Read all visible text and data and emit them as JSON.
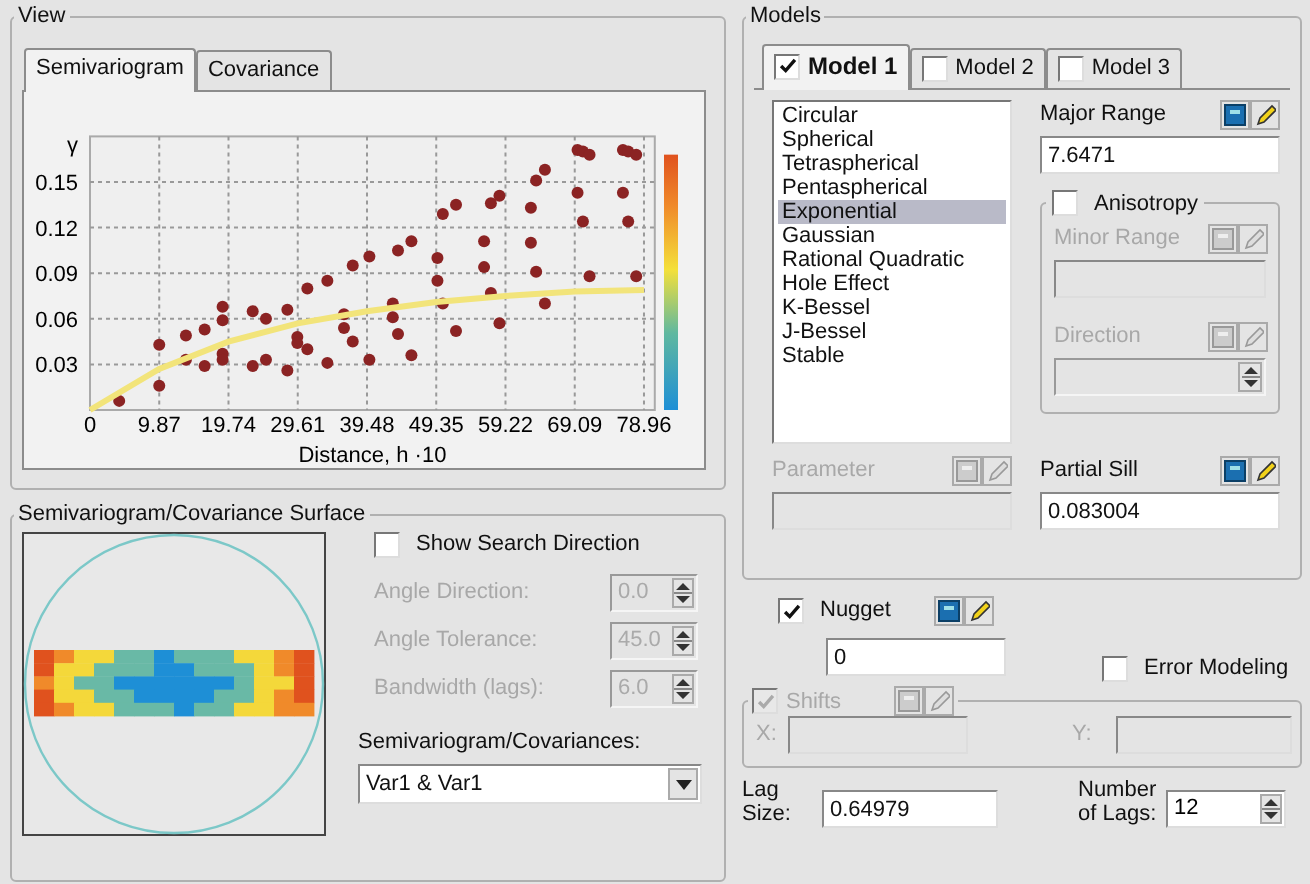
{
  "view": {
    "title": "View",
    "tabs": [
      {
        "label": "Semivariogram",
        "selected": true
      },
      {
        "label": "Covariance",
        "selected": false
      }
    ],
    "chart_data": {
      "type": "scatter",
      "xlabel": "Distance, h ·10",
      "ylabel": "γ",
      "xlim": [
        0,
        80.5
      ],
      "ylim": [
        0,
        0.18
      ],
      "xticks": [
        {
          "value": 0,
          "label": "0"
        },
        {
          "value": 9.87,
          "label": "9.87"
        },
        {
          "value": 19.74,
          "label": "19.74"
        },
        {
          "value": 29.61,
          "label": "29.61"
        },
        {
          "value": 39.48,
          "label": "39.48"
        },
        {
          "value": 49.35,
          "label": "49.35"
        },
        {
          "value": 59.22,
          "label": "59.22"
        },
        {
          "value": 69.09,
          "label": "69.09"
        },
        {
          "value": 78.96,
          "label": "78.96"
        }
      ],
      "yticks": [
        {
          "value": 0.03,
          "label": "0.03"
        },
        {
          "value": 0.06,
          "label": "0.06"
        },
        {
          "value": 0.09,
          "label": "0.09"
        },
        {
          "value": 0.12,
          "label": "0.12"
        },
        {
          "value": 0.15,
          "label": "0.15"
        }
      ],
      "x": [
        4.16,
        9.87,
        9.87,
        13.67,
        13.67,
        16.34,
        16.34,
        18.9,
        18.9,
        18.9,
        18.9,
        23.19,
        23.19,
        25.08,
        25.08,
        28.13,
        28.13,
        29.55,
        29.55,
        30.98,
        30.98,
        33.83,
        33.83,
        36.2,
        36.2,
        37.45,
        37.45,
        39.82,
        39.82,
        43.16,
        43.16,
        43.9,
        43.9,
        45.81,
        45.81,
        49.52,
        49.52,
        50.29,
        50.29,
        52.17,
        52.17,
        56.17,
        56.17,
        57.14,
        57.14,
        58.36,
        58.36,
        62.84,
        62.84,
        63.59,
        63.59,
        64.84,
        64.84,
        69.49,
        69.49,
        70.26,
        70.26,
        71.2,
        71.2,
        75.96,
        75.96,
        76.71,
        76.71,
        77.85,
        77.85
      ],
      "grid": true,
      "series": [
        {
          "color": "#8b2323",
          "values": [
            0.006,
            0.016,
            0.043,
            0.049,
            0.033,
            0.053,
            0.029,
            0.068,
            0.059,
            0.037,
            0.033,
            0.065,
            0.029,
            0.06,
            0.033,
            0.066,
            0.026,
            0.048,
            0.044,
            0.04,
            0.08,
            0.085,
            0.031,
            0.063,
            0.054,
            0.045,
            0.095,
            0.101,
            0.033,
            0.07,
            0.061,
            0.05,
            0.105,
            0.111,
            0.036,
            0.1,
            0.085,
            0.07,
            0.129,
            0.135,
            0.052,
            0.111,
            0.094,
            0.136,
            0.077,
            0.141,
            0.057,
            0.133,
            0.11,
            0.151,
            0.091,
            0.158,
            0.07,
            0.171,
            0.143,
            0.17,
            0.124,
            0.168,
            0.088,
            0.171,
            0.143,
            0.17,
            0.124,
            0.168,
            0.088
          ]
        },
        {
          "color": "#f2e47a",
          "type": "line",
          "x": [
            0,
            9.87,
            19.74,
            29.61,
            39.48,
            49.35,
            59.22,
            69.09,
            78.96
          ],
          "values": [
            0,
            0.027,
            0.045,
            0.057,
            0.065,
            0.071,
            0.075,
            0.078,
            0.079
          ]
        }
      ]
    }
  },
  "surface": {
    "title": "Semivariogram/Covariance Surface",
    "show_search_direction": {
      "label": "Show Search Direction",
      "checked": false
    },
    "fields": [
      {
        "label": "Angle Direction:",
        "value": "0.0",
        "disabled": true
      },
      {
        "label": "Angle Tolerance:",
        "value": "45.0",
        "disabled": true
      },
      {
        "label": "Bandwidth (lags):",
        "value": "6.0",
        "disabled": true
      }
    ],
    "variable_pair": {
      "label": "Semivariogram/Covariances:",
      "value": "Var1 & Var1"
    }
  },
  "models": {
    "title": "Models",
    "tabs": [
      {
        "label": "Model 1",
        "checked": true,
        "selected": true
      },
      {
        "label": "Model 2",
        "checked": false,
        "selected": false
      },
      {
        "label": "Model 3",
        "checked": false,
        "selected": false
      }
    ],
    "model_types": [
      {
        "label": "Circular",
        "selected": false
      },
      {
        "label": "Spherical",
        "selected": false
      },
      {
        "label": "Tetraspherical",
        "selected": false
      },
      {
        "label": "Pentaspherical",
        "selected": false
      },
      {
        "label": "Exponential",
        "selected": true
      },
      {
        "label": "Gaussian",
        "selected": false
      },
      {
        "label": "Rational Quadratic",
        "selected": false
      },
      {
        "label": "Hole Effect",
        "selected": false
      },
      {
        "label": "K-Bessel",
        "selected": false
      },
      {
        "label": "J-Bessel",
        "selected": false
      },
      {
        "label": "Stable",
        "selected": false
      }
    ],
    "major_range": {
      "label": "Major Range",
      "value": "7.6471",
      "disabled": false
    },
    "anisotropy": {
      "label": "Anisotropy",
      "checked": false
    },
    "minor_range": {
      "label": "Minor Range",
      "disabled": true
    },
    "direction": {
      "label": "Direction",
      "disabled": true
    },
    "parameter": {
      "label": "Parameter",
      "disabled": true
    },
    "partial_sill": {
      "label": "Partial Sill",
      "value": "0.083004",
      "disabled": false
    }
  },
  "nugget": {
    "label": "Nugget",
    "checked": true,
    "value": "0"
  },
  "error_modeling": {
    "label": "Error Modeling",
    "checked": false
  },
  "shifts": {
    "label": "Shifts",
    "checked": true,
    "disabled": true,
    "x_label": "X:",
    "y_label": "Y:"
  },
  "lag_size": {
    "label": "Lag Size:",
    "value": "0.64979"
  },
  "number_of_lags": {
    "label": "Number of Lags:",
    "value": "12"
  }
}
